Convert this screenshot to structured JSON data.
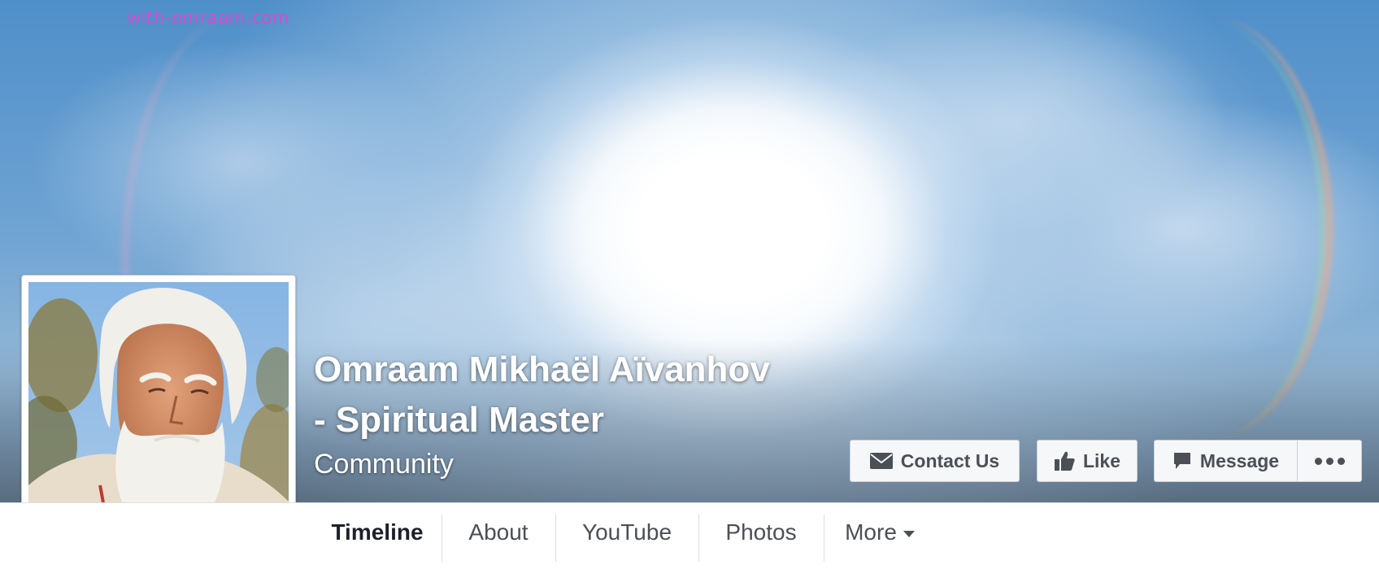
{
  "cover": {
    "watermark": "with-omraam.com"
  },
  "page": {
    "name_line1": "Omraam Mikhaël Aïvanhov",
    "name_line2": "- Spiritual Master",
    "category": "Community"
  },
  "actions": {
    "contact_label": "Contact Us",
    "like_label": "Like",
    "message_label": "Message",
    "more_icon": "ellipsis-icon"
  },
  "nav": {
    "tabs": [
      {
        "label": "Timeline",
        "active": true
      },
      {
        "label": "About"
      },
      {
        "label": "YouTube"
      },
      {
        "label": "Photos"
      },
      {
        "label": "More"
      }
    ]
  },
  "colors": {
    "button_bg": "#f6f7f9",
    "button_text": "#4b4f56",
    "active_tab": "#1d2129",
    "watermark": "#d84ad0"
  }
}
